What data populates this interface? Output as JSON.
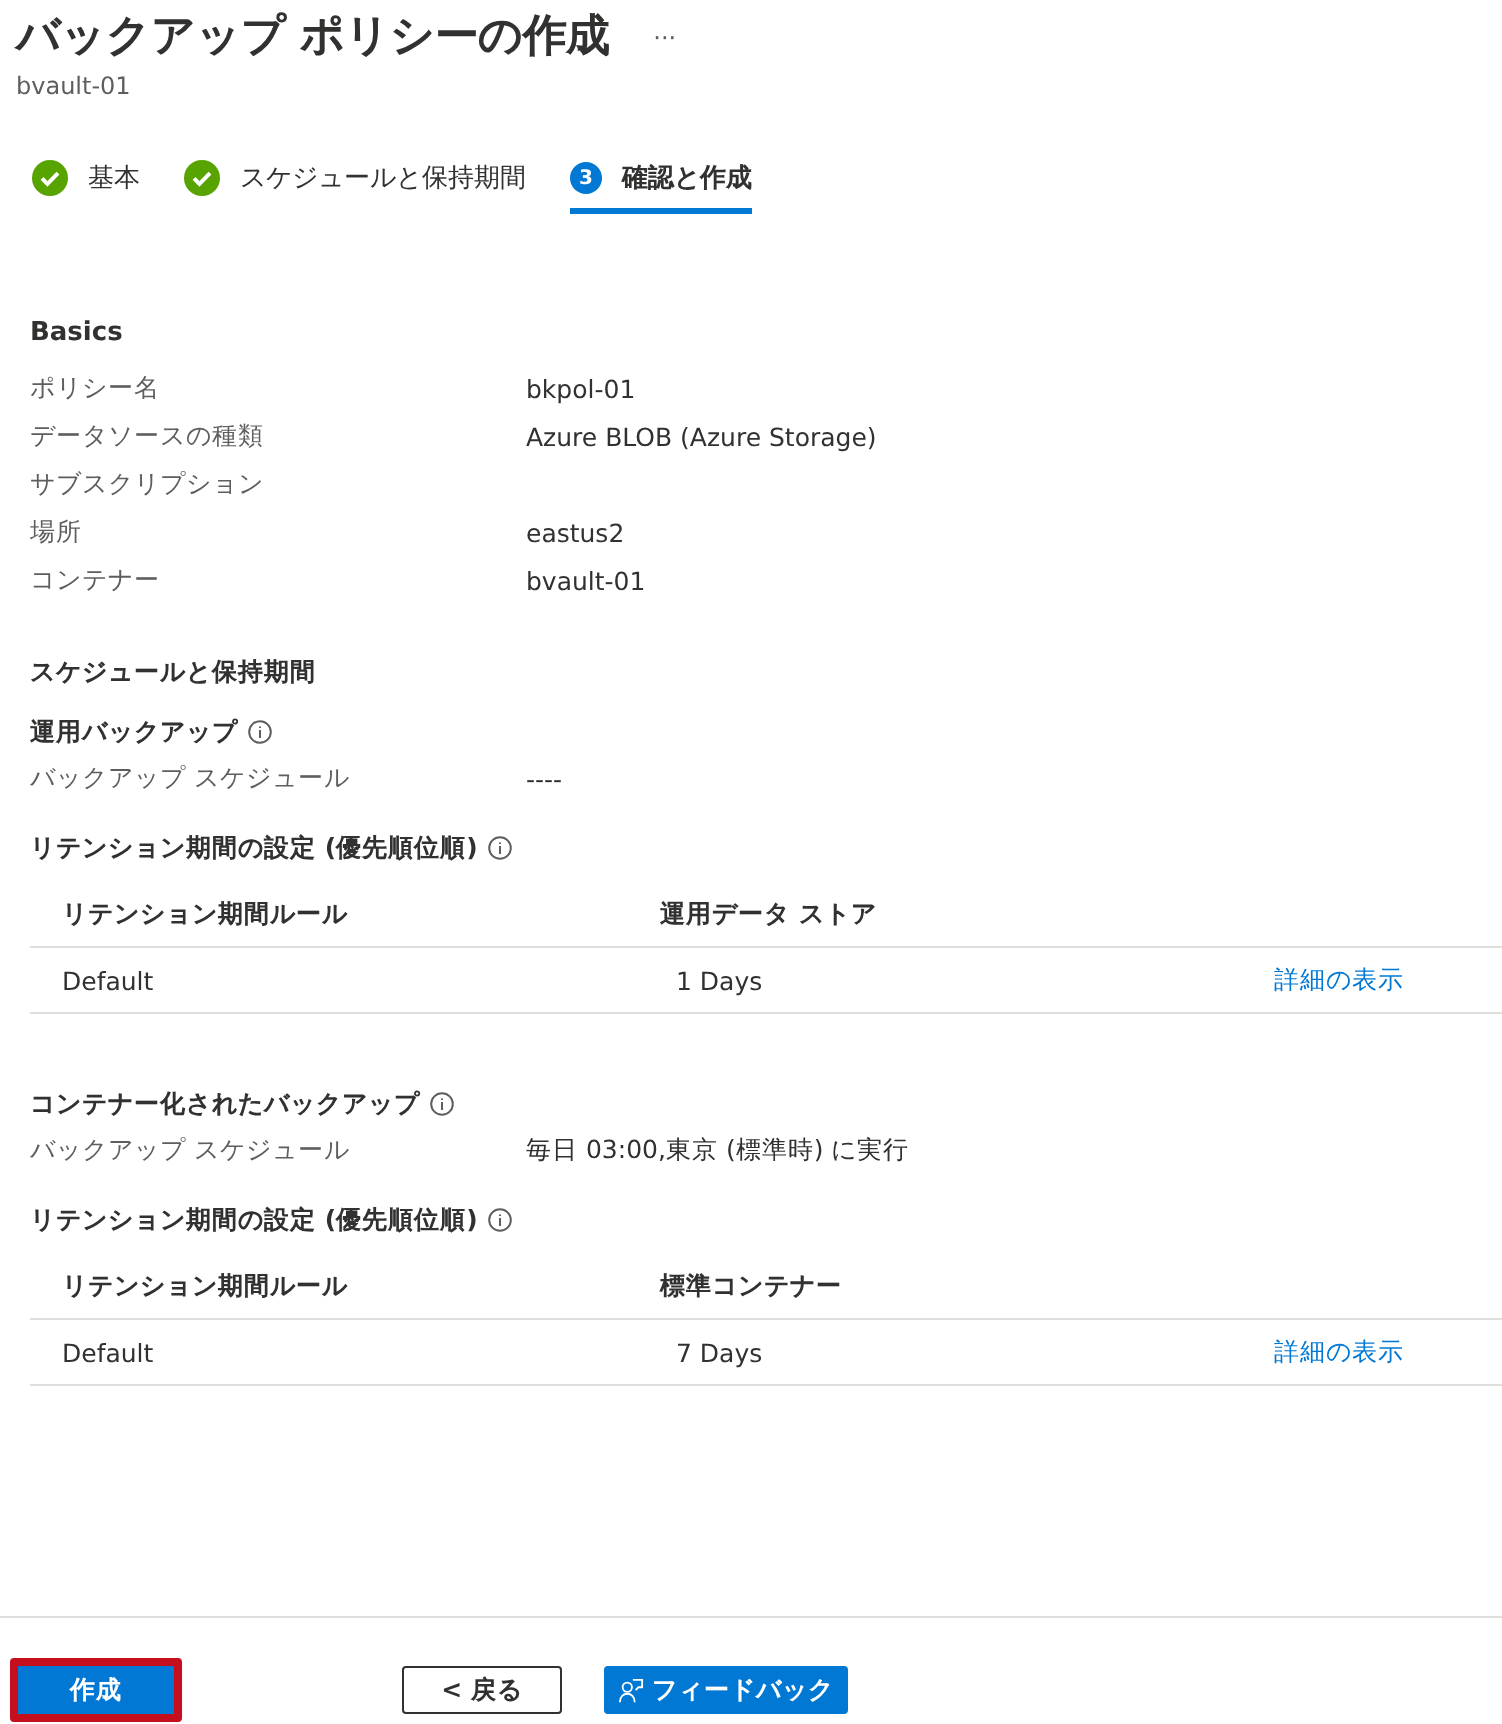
{
  "header": {
    "title": "バックアップ ポリシーの作成",
    "more": "···",
    "subtitle": "bvault-01"
  },
  "steps": [
    {
      "kind": "done",
      "label": "基本",
      "selected": false
    },
    {
      "kind": "done",
      "label": "スケジュールと保持期間",
      "selected": false
    },
    {
      "kind": "number",
      "number": "3",
      "label": "確認と作成",
      "selected": true
    }
  ],
  "basics": {
    "title": "Basics",
    "rows": [
      {
        "label": "ポリシー名",
        "value": "bkpol-01"
      },
      {
        "label": "データソースの種類",
        "value": "Azure BLOB (Azure Storage)"
      },
      {
        "label": "サブスクリプション"
      },
      {
        "label": "場所",
        "value": "eastus2"
      },
      {
        "label": "コンテナー",
        "value": "bvault-01"
      }
    ]
  },
  "schedule": {
    "title": "スケジュールと保持期間",
    "groups": [
      {
        "title": "運用バックアップ",
        "rows": [
          {
            "label": "バックアップ スケジュール",
            "value": "----"
          }
        ],
        "retention": {
          "title": "リテンション期間の設定 (優先順位順)",
          "columns": [
            "リテンション期間ルール",
            "運用データ ストア"
          ],
          "rows": [
            {
              "rule": "Default",
              "value": "1 Days",
              "link": "詳細の表示"
            }
          ]
        }
      },
      {
        "title": "コンテナー化されたバックアップ",
        "rows": [
          {
            "label": "バックアップ スケジュール",
            "value": "毎日 03:00,東京 (標準時) に実行"
          }
        ],
        "retention": {
          "title": "リテンション期間の設定 (優先順位順)",
          "columns": [
            "リテンション期間ルール",
            "標準コンテナー"
          ],
          "rows": [
            {
              "rule": "Default",
              "value": "7 Days",
              "link": "詳細の表示"
            }
          ]
        }
      }
    ]
  },
  "footer": {
    "buttons": [
      {
        "kind": "primary",
        "label": "作成",
        "highlighted": true
      },
      {
        "kind": "secondary",
        "label": "< 戻る",
        "highlighted": false
      },
      {
        "kind": "feedback",
        "label": "フィードバック",
        "highlighted": false
      }
    ]
  }
}
